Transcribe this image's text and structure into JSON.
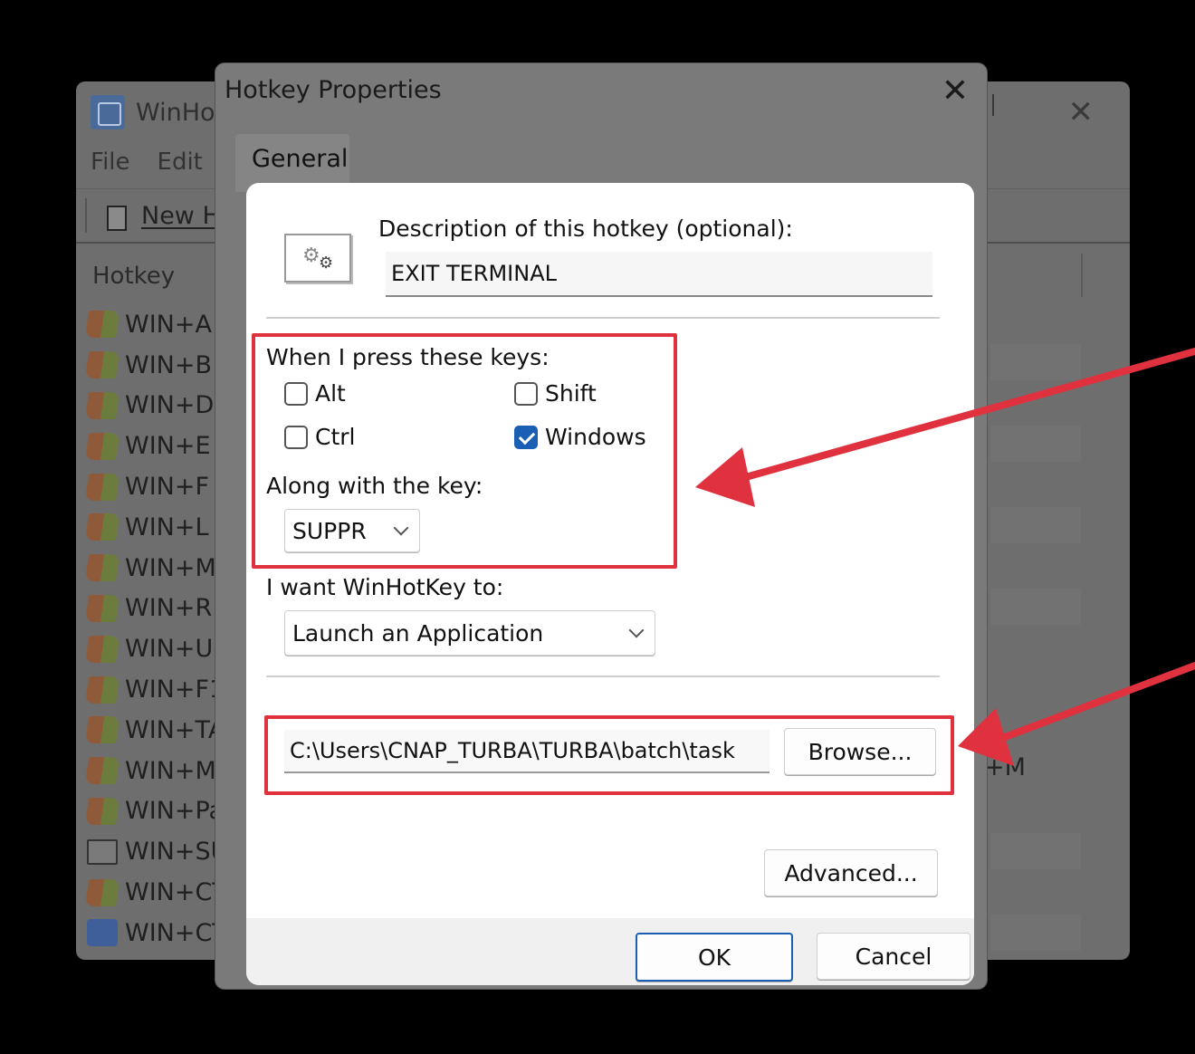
{
  "parent_window": {
    "title": "WinHo",
    "menu": [
      "File",
      "Edit"
    ],
    "toolbar_new_label": "New H",
    "list_header": "Hotkey",
    "rows": [
      {
        "label": "WIN+A",
        "icon": "flag-icon"
      },
      {
        "label": "WIN+B",
        "icon": "flag-icon"
      },
      {
        "label": "WIN+D",
        "icon": "flag-icon"
      },
      {
        "label": "WIN+E",
        "icon": "flag-icon"
      },
      {
        "label": "WIN+F",
        "icon": "flag-icon"
      },
      {
        "label": "WIN+L",
        "icon": "flag-icon"
      },
      {
        "label": "WIN+M",
        "icon": "flag-icon"
      },
      {
        "label": "WIN+R",
        "icon": "flag-icon"
      },
      {
        "label": "WIN+U",
        "icon": "flag-icon"
      },
      {
        "label": "WIN+F1",
        "icon": "flag-icon"
      },
      {
        "label": "WIN+TA",
        "icon": "flag-icon"
      },
      {
        "label": "WIN+M",
        "icon": "flag-icon"
      },
      {
        "label": "WIN+Pa",
        "icon": "flag-icon"
      },
      {
        "label": "WIN+SU",
        "icon": "box-icon"
      },
      {
        "label": "WIN+CT",
        "icon": "flag-icon"
      },
      {
        "label": "WIN+CT",
        "icon": "winhotkey-icon"
      }
    ],
    "right_fragment": "+M"
  },
  "dialog": {
    "title": "Hotkey Properties",
    "tab": "General",
    "description_label": "Description of this hotkey (optional):",
    "description_value": "EXIT TERMINAL",
    "keys_label": "When I press these keys:",
    "modifiers": [
      {
        "label": "Alt",
        "checked": false
      },
      {
        "label": "Shift",
        "checked": false
      },
      {
        "label": "Ctrl",
        "checked": false
      },
      {
        "label": "Windows",
        "checked": true
      }
    ],
    "along_label": "Along with the key:",
    "key_value": "SUPPR",
    "want_label": "I want WinHotKey to:",
    "action_value": "Launch an Application",
    "path_value": "C:\\Users\\CNAP_TURBA\\TURBA\\batch\\task",
    "browse_label": "Browse...",
    "advanced_label": "Advanced...",
    "ok_label": "OK",
    "cancel_label": "Cancel"
  },
  "colors": {
    "annotation_red": "#e0313f",
    "checkbox_blue": "#1a5fb4"
  }
}
